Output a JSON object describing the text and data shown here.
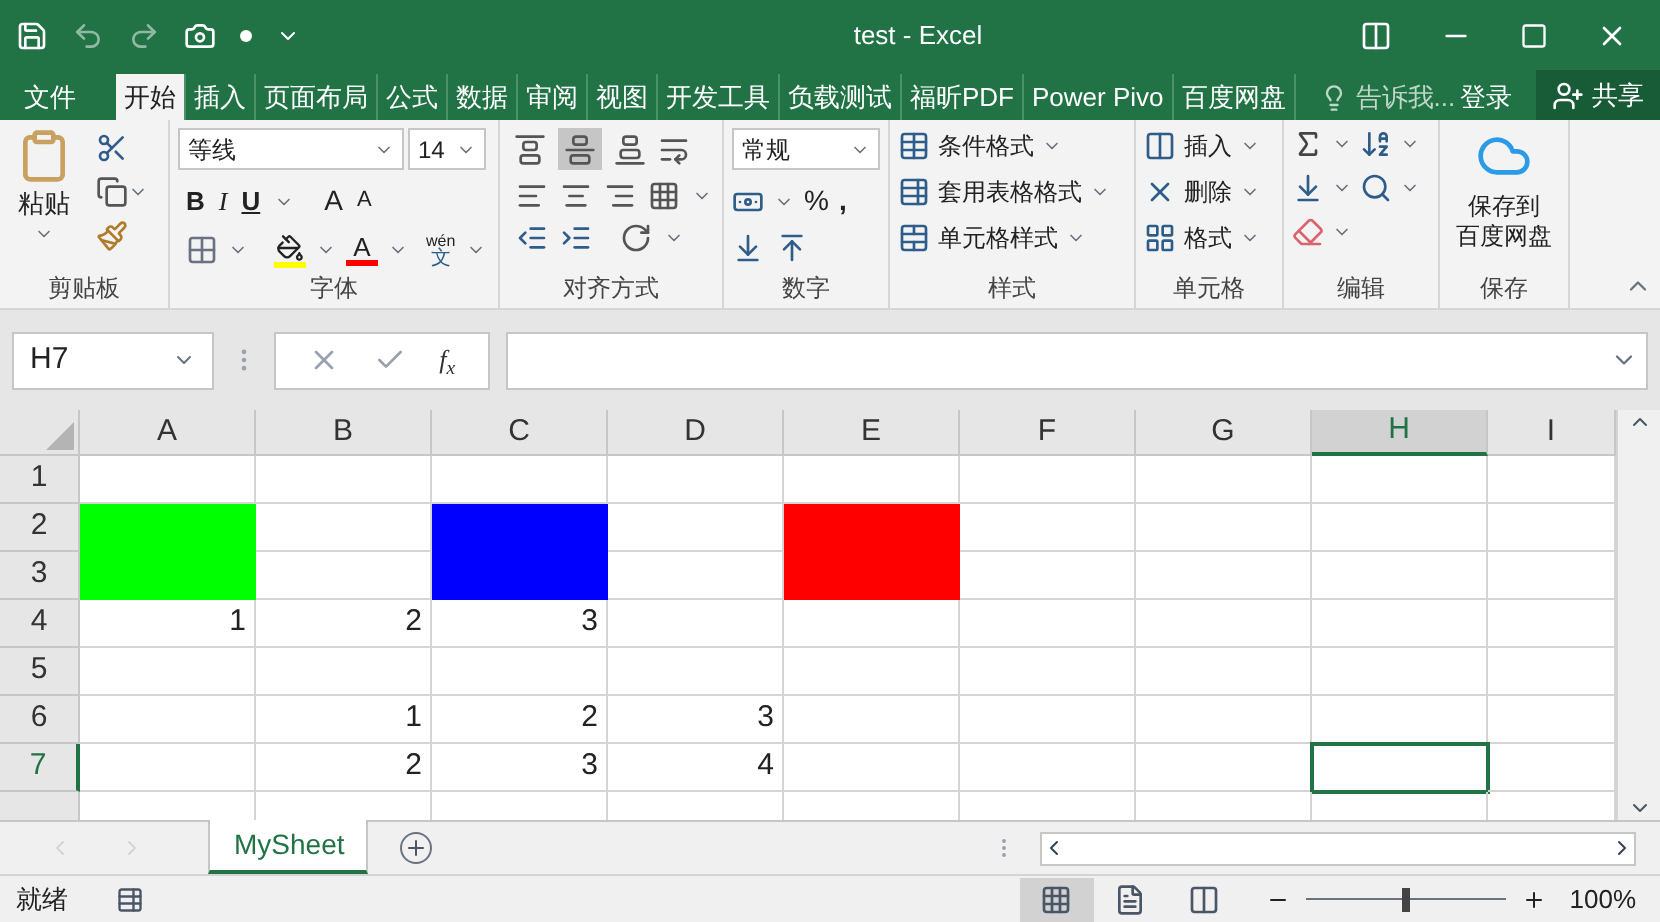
{
  "window": {
    "title": "test - Excel"
  },
  "ribbon_tabs": [
    {
      "label": "文件",
      "selected": false
    },
    {
      "label": "开始",
      "selected": true
    },
    {
      "label": "插入",
      "selected": false
    },
    {
      "label": "页面布局",
      "selected": false
    },
    {
      "label": "公式",
      "selected": false
    },
    {
      "label": "数据",
      "selected": false
    },
    {
      "label": "审阅",
      "selected": false
    },
    {
      "label": "视图",
      "selected": false
    },
    {
      "label": "开发工具",
      "selected": false
    },
    {
      "label": "负载测试",
      "selected": false
    },
    {
      "label": "福昕PDF",
      "selected": false
    },
    {
      "label": "Power Pivo",
      "selected": false
    },
    {
      "label": "百度网盘",
      "selected": false
    }
  ],
  "tell_me": "告诉我...",
  "sign_in": "登录",
  "share": "共享",
  "ribbon": {
    "clipboard": {
      "label": "剪贴板",
      "paste": "粘贴"
    },
    "font": {
      "label": "字体",
      "font_name": "等线",
      "font_size": "14",
      "bold": "B",
      "italic": "I",
      "underline": "U",
      "grow": "A",
      "shrink": "A",
      "font_color": "A",
      "phonetic_top": "wén",
      "phonetic_bottom": "文"
    },
    "alignment": {
      "label": "对齐方式",
      "vertical": [
        {
          "selected": false
        },
        {
          "selected": true
        },
        {
          "selected": false
        }
      ]
    },
    "number": {
      "label": "数字",
      "format": "常规",
      "percent": "%",
      "comma": ","
    },
    "styles": {
      "label": "样式",
      "buttons": [
        "条件格式",
        "套用表格格式",
        "单元格样式"
      ]
    },
    "cells": {
      "label": "单元格",
      "buttons": [
        "插入",
        "删除",
        "格式"
      ]
    },
    "editing": {
      "label": "编辑"
    },
    "save": {
      "label": "保存",
      "lines": [
        "保存到",
        "百度网盘"
      ]
    }
  },
  "formula_bar": {
    "name_box": "H7",
    "function_label": "f$_{x}$"
  },
  "columns": [
    {
      "label": "A",
      "selected": false
    },
    {
      "label": "B",
      "selected": false
    },
    {
      "label": "C",
      "selected": false
    },
    {
      "label": "D",
      "selected": false
    },
    {
      "label": "E",
      "selected": false
    },
    {
      "label": "F",
      "selected": false
    },
    {
      "label": "G",
      "selected": false
    },
    {
      "label": "H",
      "selected": true
    },
    {
      "label": "I",
      "selected": false
    }
  ],
  "rows": [
    {
      "label": "1",
      "selected": false,
      "cells": [
        null,
        null,
        null,
        null,
        null,
        null,
        null,
        null,
        null
      ]
    },
    {
      "label": "2",
      "selected": false,
      "cells": [
        {
          "color": "#00ff00"
        },
        null,
        {
          "color": "#0000ff"
        },
        null,
        {
          "color": "#ff0000"
        },
        null,
        null,
        null,
        null
      ]
    },
    {
      "label": "3",
      "selected": false,
      "cells": [
        {
          "color": "#00ff00"
        },
        null,
        {
          "color": "#0000ff"
        },
        null,
        {
          "color": "#ff0000"
        },
        null,
        null,
        null,
        null
      ]
    },
    {
      "label": "4",
      "selected": false,
      "cells": [
        {
          "text": "1"
        },
        {
          "text": "2"
        },
        {
          "text": "3"
        },
        null,
        null,
        null,
        null,
        null,
        null
      ]
    },
    {
      "label": "5",
      "selected": false,
      "cells": [
        null,
        null,
        null,
        null,
        null,
        null,
        null,
        null,
        null
      ]
    },
    {
      "label": "6",
      "selected": false,
      "cells": [
        null,
        {
          "text": "1"
        },
        {
          "text": "2"
        },
        {
          "text": "3"
        },
        null,
        null,
        null,
        null,
        null
      ]
    },
    {
      "label": "7",
      "selected": true,
      "cells": [
        null,
        {
          "text": "2"
        },
        {
          "text": "3"
        },
        {
          "text": "4"
        },
        null,
        null,
        null,
        null,
        null
      ]
    }
  ],
  "sheet_tabs": [
    {
      "label": "MySheet",
      "selected": true
    }
  ],
  "status": {
    "text": "就绪",
    "views": [
      {
        "selected": true
      },
      {
        "selected": false
      },
      {
        "selected": false
      }
    ],
    "zoom_slider": {
      "level": 0.5
    },
    "zoom": "100%"
  }
}
